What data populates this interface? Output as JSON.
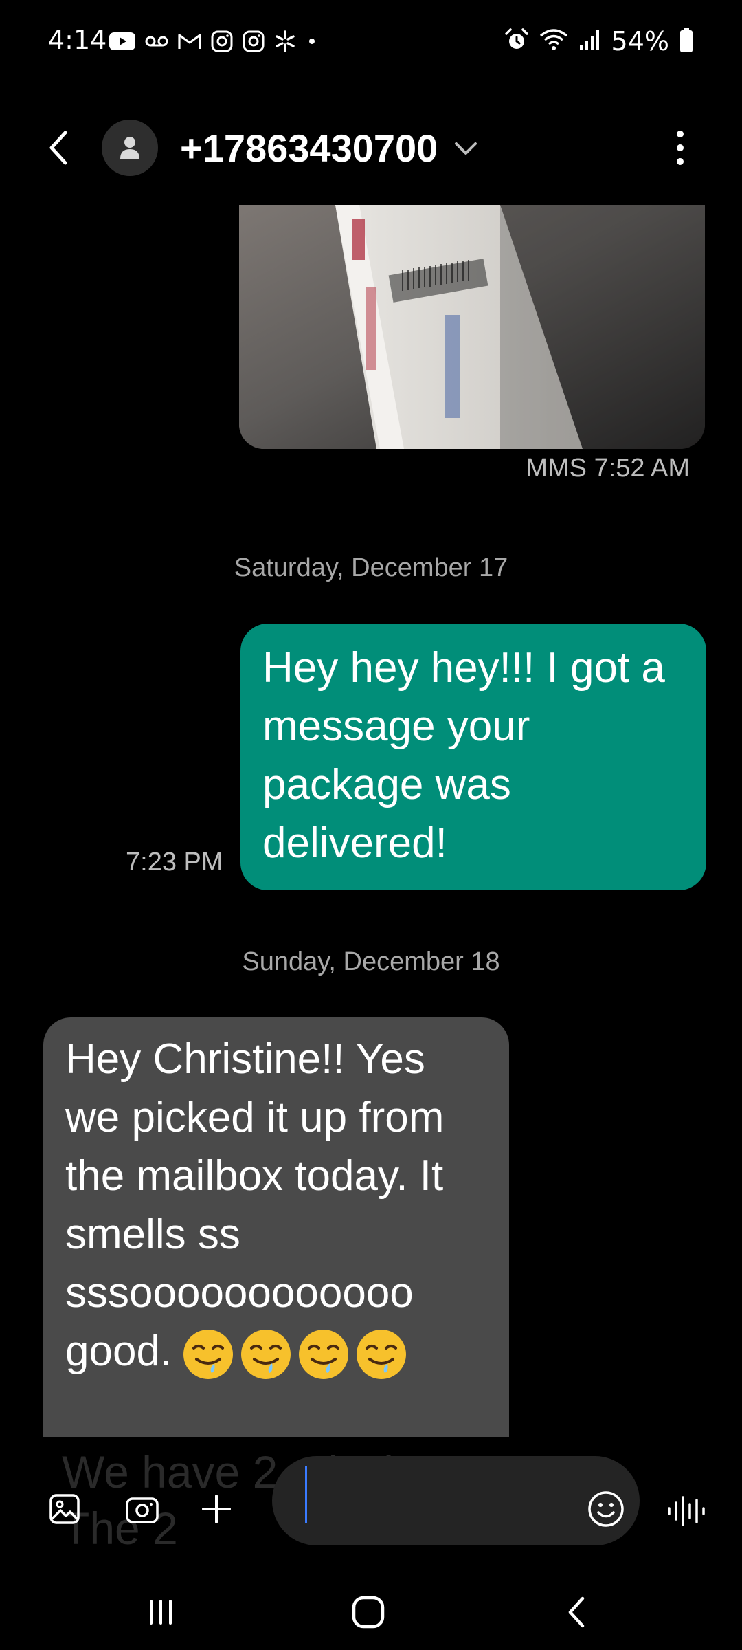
{
  "status_bar": {
    "time": "4:14",
    "battery": "54%",
    "left_icons": [
      "youtube-icon",
      "voicemail-icon",
      "gmail-icon",
      "instagram-icon",
      "instagram-icon",
      "walmart-icon",
      "dot-icon"
    ],
    "right_icons": [
      "alarm-icon",
      "wifi-icon",
      "signal-icon",
      "battery-icon"
    ]
  },
  "header": {
    "contact": "+17863430700",
    "back_icon": "chevron-left-icon",
    "avatar_icon": "person-icon",
    "expand_icon": "chevron-down-icon",
    "menu_icon": "more-vertical-icon"
  },
  "conversation": {
    "mms": {
      "type_label": "MMS",
      "time": "7:52 AM"
    },
    "date_1": "Saturday, December 17",
    "sent_message": {
      "text": "Hey hey hey!!! I got a message your package was delivered!",
      "time": "7:23 PM"
    },
    "date_2": "Sunday, December 18",
    "received_message": {
      "text": "Hey Christine!! Yes we picked it up from the mailbox today. It smells ss sssoooooooooooo good.",
      "emoji_count": 4,
      "emoji": "drooling-face"
    },
    "next_message_peek": "We have 2 missing. The 2"
  },
  "compose": {
    "placeholder": "",
    "value": "",
    "icons": [
      "gallery-icon",
      "camera-icon",
      "plus-icon",
      "emoji-icon",
      "voice-icon"
    ]
  },
  "nav_bar": {
    "icons": [
      "recents-icon",
      "home-icon",
      "back-icon"
    ]
  },
  "colors": {
    "background": "#000000",
    "sent_bubble": "#018e79",
    "received_bubble": "#4a4a4a",
    "input_bg": "#242424",
    "cursor": "#3a7bff"
  }
}
